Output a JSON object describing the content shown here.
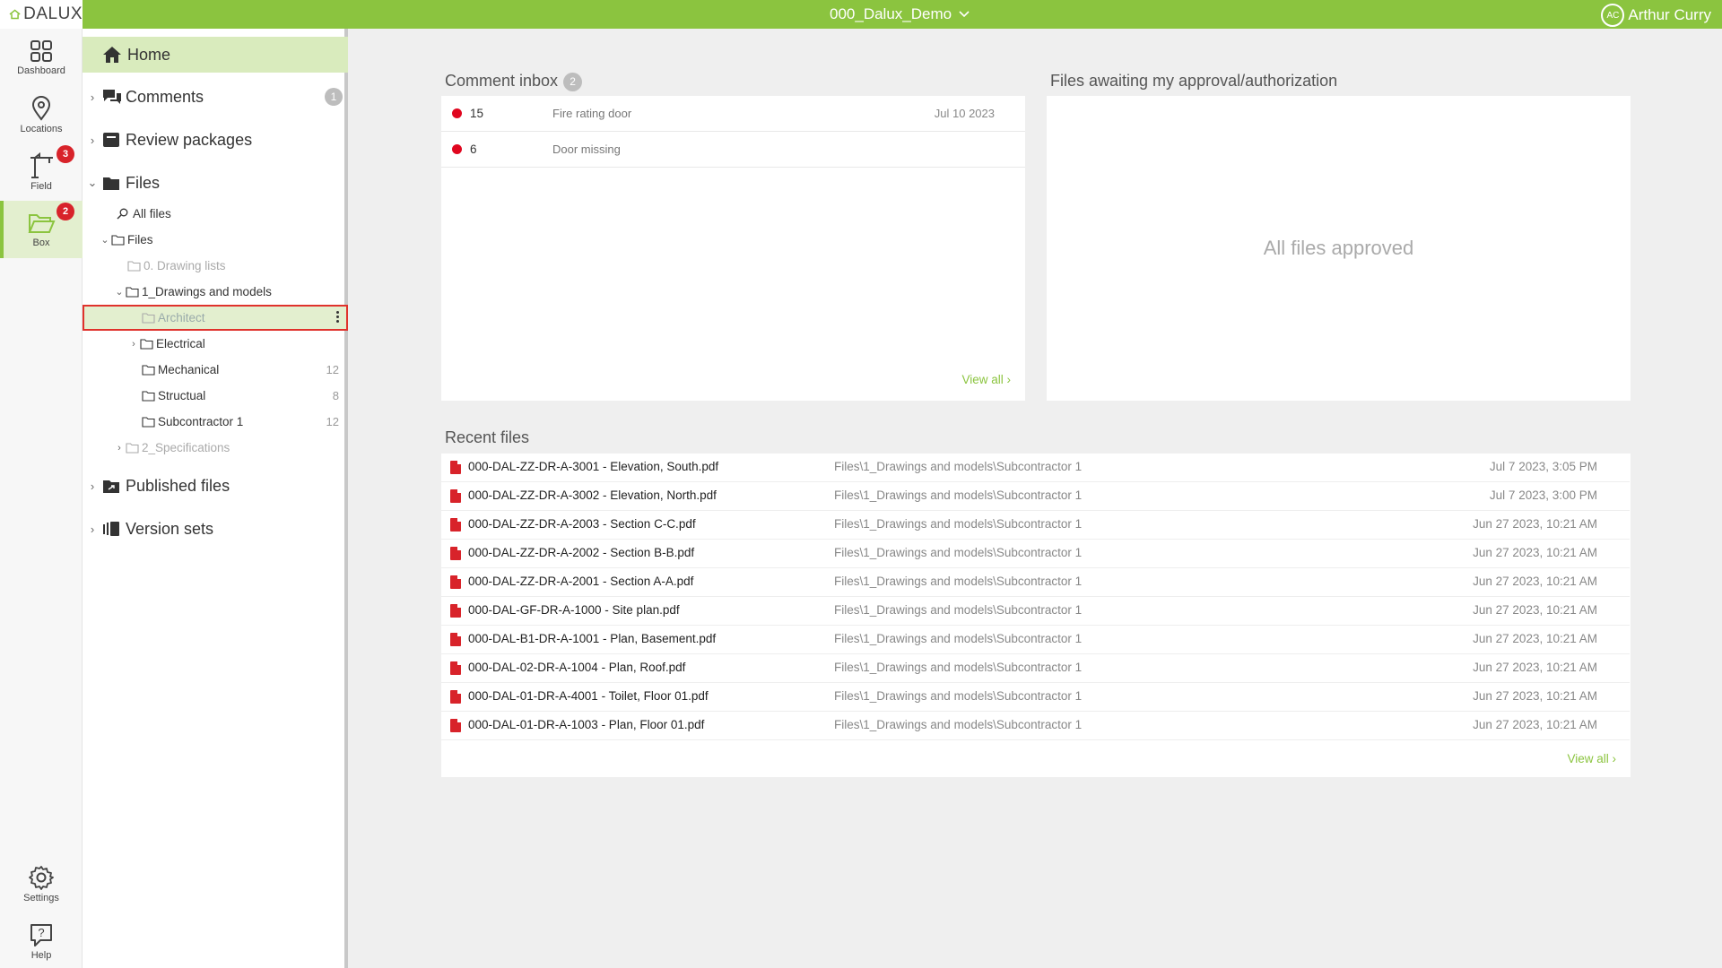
{
  "header": {
    "logo": "DALUX",
    "project": "000_Dalux_Demo",
    "user_initials": "AC",
    "user_name": "Arthur Curry"
  },
  "rail": {
    "dashboard": "Dashboard",
    "locations": "Locations",
    "field": "Field",
    "field_badge": "3",
    "box": "Box",
    "box_badge": "2",
    "settings": "Settings",
    "help": "Help"
  },
  "nav": {
    "home": "Home",
    "comments": "Comments",
    "comments_badge": "1",
    "review_packages": "Review packages",
    "files": "Files",
    "all_files": "All files",
    "files_root": "Files",
    "drawing_lists": "0. Drawing lists",
    "drawings_models": "1_Drawings and models",
    "architect": "Architect",
    "electrical": "Electrical",
    "mechanical": "Mechanical",
    "mechanical_count": "12",
    "structual": "Structual",
    "structual_count": "8",
    "subcontractor": "Subcontractor 1",
    "subcontractor_count": "12",
    "specifications": "2_Specifications",
    "published_files": "Published files",
    "version_sets": "Version sets"
  },
  "comment_inbox": {
    "title": "Comment inbox",
    "count": "2",
    "rows": [
      {
        "num": "15",
        "title": "Fire rating door",
        "date": "Jul 10 2023"
      },
      {
        "num": "6",
        "title": "Door missing",
        "date": ""
      }
    ],
    "view_all": "View all ›"
  },
  "approval": {
    "title": "Files awaiting my approval/authorization",
    "empty": "All files approved"
  },
  "recent_files": {
    "title": "Recent files",
    "rows": [
      {
        "name": "000-DAL-ZZ-DR-A-3001 - Elevation, South.pdf",
        "path": "Files\\1_Drawings and models\\Subcontractor 1",
        "date": "Jul 7 2023, 3:05 PM"
      },
      {
        "name": "000-DAL-ZZ-DR-A-3002 - Elevation, North.pdf",
        "path": "Files\\1_Drawings and models\\Subcontractor 1",
        "date": "Jul 7 2023, 3:00 PM"
      },
      {
        "name": "000-DAL-ZZ-DR-A-2003 - Section C-C.pdf",
        "path": "Files\\1_Drawings and models\\Subcontractor 1",
        "date": "Jun 27 2023, 10:21 AM"
      },
      {
        "name": "000-DAL-ZZ-DR-A-2002 - Section B-B.pdf",
        "path": "Files\\1_Drawings and models\\Subcontractor 1",
        "date": "Jun 27 2023, 10:21 AM"
      },
      {
        "name": "000-DAL-ZZ-DR-A-2001 - Section A-A.pdf",
        "path": "Files\\1_Drawings and models\\Subcontractor 1",
        "date": "Jun 27 2023, 10:21 AM"
      },
      {
        "name": "000-DAL-GF-DR-A-1000 - Site plan.pdf",
        "path": "Files\\1_Drawings and models\\Subcontractor 1",
        "date": "Jun 27 2023, 10:21 AM"
      },
      {
        "name": "000-DAL-B1-DR-A-1001 - Plan, Basement.pdf",
        "path": "Files\\1_Drawings and models\\Subcontractor 1",
        "date": "Jun 27 2023, 10:21 AM"
      },
      {
        "name": "000-DAL-02-DR-A-1004 - Plan, Roof.pdf",
        "path": "Files\\1_Drawings and models\\Subcontractor 1",
        "date": "Jun 27 2023, 10:21 AM"
      },
      {
        "name": "000-DAL-01-DR-A-4001 - Toilet, Floor 01.pdf",
        "path": "Files\\1_Drawings and models\\Subcontractor 1",
        "date": "Jun 27 2023, 10:21 AM"
      },
      {
        "name": "000-DAL-01-DR-A-1003 - Plan, Floor 01.pdf",
        "path": "Files\\1_Drawings and models\\Subcontractor 1",
        "date": "Jun 27 2023, 10:21 AM"
      }
    ],
    "view_all": "View all ›"
  },
  "colors": {
    "accent": "#8bc43f",
    "selection": "#e3efcf",
    "badge_red": "#d8232a"
  }
}
